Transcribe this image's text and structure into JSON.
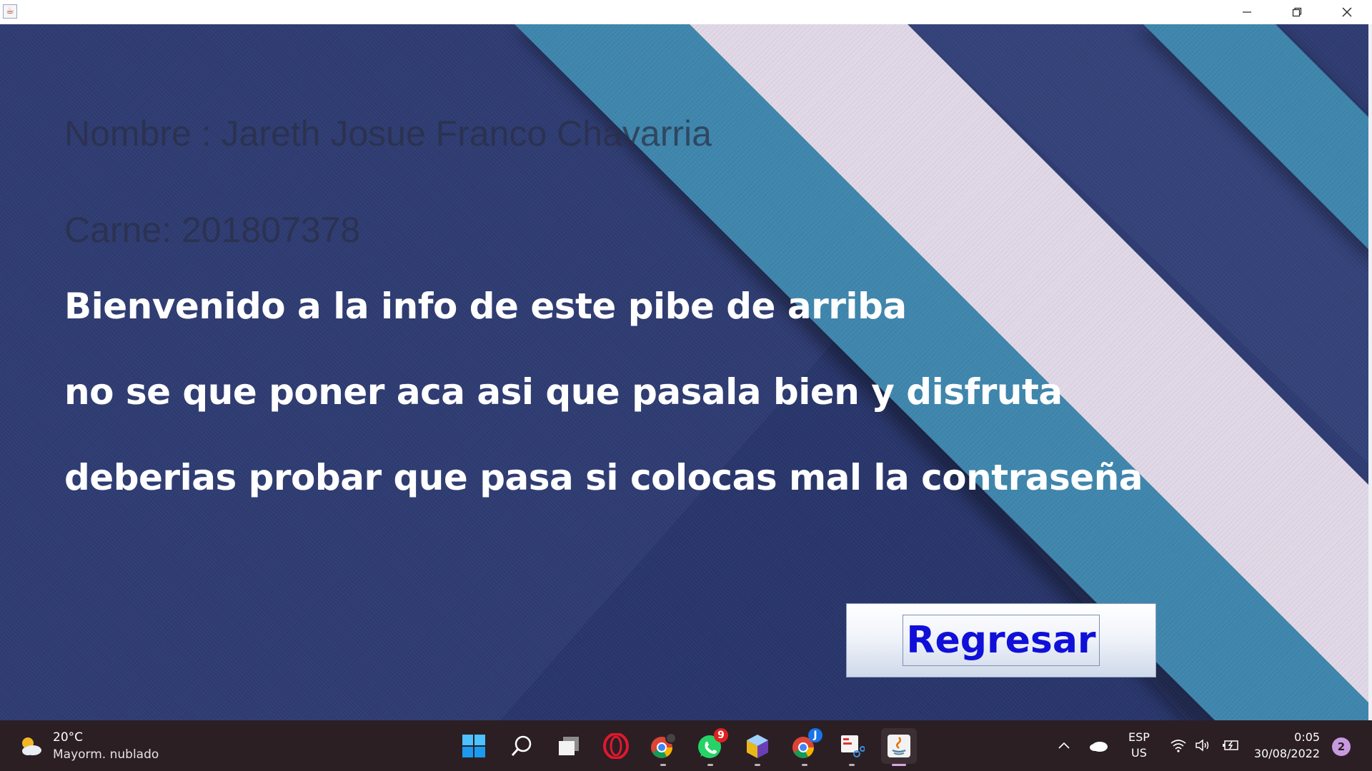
{
  "window": {
    "controls": {
      "minimize": "minimize",
      "maximize": "restore",
      "close": "close"
    }
  },
  "info": {
    "nombre": "Nombre : Jareth Josue Franco Chavarria",
    "carne": "Carne: 201807378",
    "lines": [
      "Bienvenido a la info de este pibe de arriba",
      "no se que poner aca asi que pasala bien y disfruta",
      "deberias probar que pasa si colocas mal la contraseña"
    ]
  },
  "buttons": {
    "regresar": "Regresar"
  },
  "colors": {
    "background_navy": "#2f3c72",
    "stripe_teal": "#3f86ad",
    "stripe_lavender": "#e0d8e6",
    "button_text": "#1010d8",
    "taskbar": "#2b1f24"
  },
  "taskbar": {
    "weather": {
      "temp": "20°C",
      "desc": "Mayorm. nublado",
      "icon": "partly-cloudy-icon"
    },
    "apps": [
      {
        "name": "start",
        "icon": "windows-start-icon"
      },
      {
        "name": "search",
        "icon": "search-icon"
      },
      {
        "name": "task-view",
        "icon": "task-view-icon"
      },
      {
        "name": "opera",
        "icon": "opera-icon"
      },
      {
        "name": "chrome-profile",
        "icon": "chrome-icon"
      },
      {
        "name": "whatsapp",
        "icon": "whatsapp-icon",
        "badge": "9"
      },
      {
        "name": "virtualbox",
        "icon": "virtualbox-icon"
      },
      {
        "name": "chrome-j",
        "icon": "chrome-icon",
        "badge": "J"
      },
      {
        "name": "snipping-tool",
        "icon": "snipping-tool-icon"
      },
      {
        "name": "java",
        "icon": "java-icon"
      }
    ],
    "tray": {
      "lang_top": "ESP",
      "lang_bottom": "US",
      "time": "0:05",
      "date": "30/08/2022",
      "notifications": "2"
    }
  }
}
